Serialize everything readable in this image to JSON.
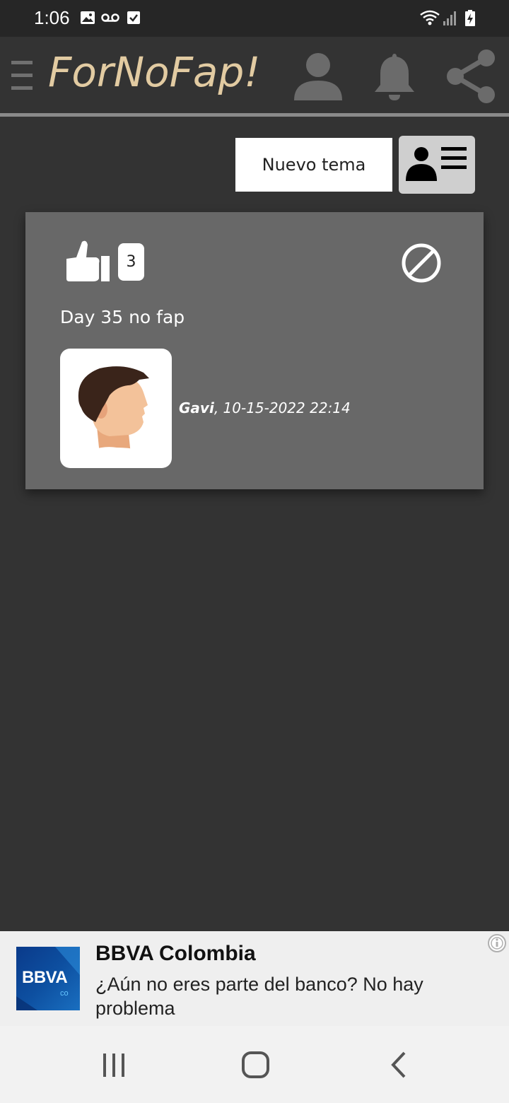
{
  "status_bar": {
    "time": "1:06",
    "icons": [
      "image-icon",
      "voicemail-icon",
      "checkbox-icon",
      "wifi-icon",
      "signal-icon",
      "battery-charging-icon"
    ]
  },
  "header": {
    "brand": "ForNoFap!",
    "icons": [
      "menu-icon",
      "user-icon",
      "bell-icon",
      "share-icon"
    ],
    "brand_color": "#e2cba2"
  },
  "actions": {
    "new_topic_label": "Nuevo tema"
  },
  "post": {
    "likes": "3",
    "title": "Day 35 no fap",
    "author": "Gavi",
    "timestamp": ", 10-15-2022 22:14"
  },
  "ad": {
    "logo_text": "BBVA",
    "logo_sub": "co",
    "title": "BBVA Colombia",
    "description": "¿Aún no eres parte del banco? No hay problema"
  },
  "nav": {
    "items": [
      "recent-apps-icon",
      "home-icon",
      "back-icon"
    ]
  }
}
